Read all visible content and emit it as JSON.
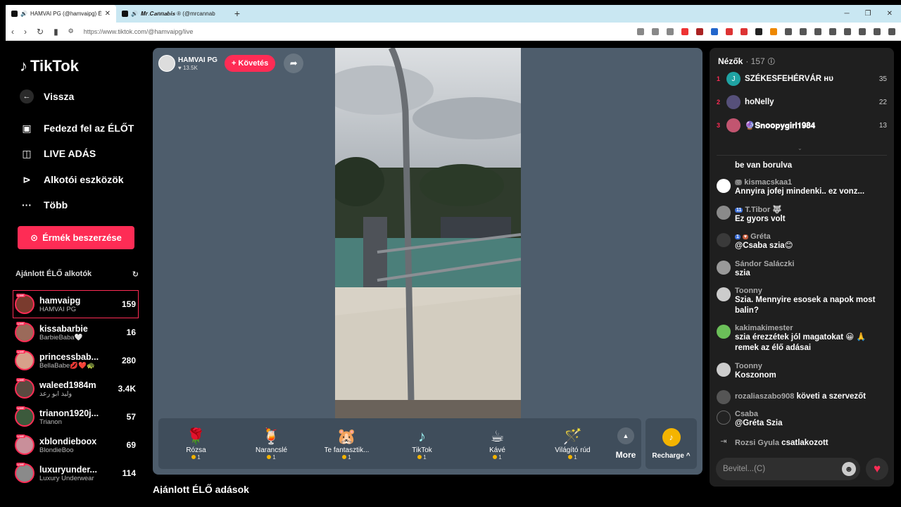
{
  "browser": {
    "tabs": [
      {
        "title": "HAMVAI PG (@hamvaipg) ÉL",
        "close": "✕"
      },
      {
        "title": "𝑴𝒓.𝑪𝒂𝒏𝒏𝒂𝒃𝒊𝒔 ® (@mrcannab"
      }
    ],
    "new_tab": "+",
    "url": "https://www.tiktok.com/@hamvaipg/live"
  },
  "sidebar": {
    "logo": "TikTok",
    "nav": [
      {
        "label": "Vissza",
        "icon": "back-arrow-icon"
      },
      {
        "label": "Fedezd fel az ÉLŐT",
        "icon": "live-explore-icon"
      },
      {
        "label": "LIVE ADÁS",
        "icon": "video-camera-icon"
      },
      {
        "label": "Alkotói eszközök",
        "icon": "creator-tools-icon"
      },
      {
        "label": "Több",
        "icon": "more-dots-icon"
      }
    ],
    "coins_button": "Érmék beszerzése",
    "recommended_title": "Ajánlott ÉLŐ alkotók",
    "creators": [
      {
        "name": "hamvaipg",
        "sub": "HAMVAI PG",
        "count": "159",
        "color": "#7a3b2e"
      },
      {
        "name": "kissabarbie",
        "sub": "BarbieBaba🤍",
        "count": "16",
        "color": "#9b6a5a"
      },
      {
        "name": "princessbab...",
        "sub": "BellaBabe💋❤️🐢",
        "count": "280",
        "color": "#d7a08a"
      },
      {
        "name": "waleed1984m",
        "sub": "وليد ابو رعد",
        "count": "3.4K",
        "color": "#5a4a40"
      },
      {
        "name": "trianon1920j...",
        "sub": "Trianon",
        "count": "57",
        "color": "#3c5a3c"
      },
      {
        "name": "xblondieboox",
        "sub": "BlondieBoo",
        "count": "69",
        "color": "#c98f9a"
      },
      {
        "name": "luxuryunder...",
        "sub": "Luxury Underwear",
        "count": "114",
        "color": "#8a8a8a"
      }
    ],
    "live_badge": "LIVE"
  },
  "stream": {
    "host_name": "HAMVAI PG",
    "host_likes": "♥ 13.5K",
    "follow_label": "+ Követés",
    "gifts": [
      {
        "name": "Rózsa",
        "price": "1",
        "icon": "🌹"
      },
      {
        "name": "Narancslé",
        "price": "1",
        "icon": "🍹"
      },
      {
        "name": "Te fantasztik...",
        "price": "1",
        "icon": "🐹"
      },
      {
        "name": "TikTok",
        "price": "1",
        "icon": "♪"
      },
      {
        "name": "Kávé",
        "price": "1",
        "icon": "☕"
      },
      {
        "name": "Világító rúd",
        "price": "1",
        "icon": "🪄"
      }
    ],
    "more_label": "More",
    "recharge_label": "Recharge ^",
    "suggested_title": "Ajánlott ÉLŐ adások"
  },
  "chat": {
    "viewers_label": "Nézők",
    "viewers_count": "· 157",
    "top_viewers": [
      {
        "rank": "1",
        "name": "SZÉKESFEHÉRVÁR ʜᴜ",
        "score": "35",
        "color": "#1fa3a3",
        "initial": "J"
      },
      {
        "rank": "2",
        "name": "hoNelly",
        "score": "22",
        "color": "#56507a",
        "initial": ""
      },
      {
        "rank": "3",
        "name": "🔮𝐒𝐧𝐨𝐨𝐩𝐲𝐠𝐢𝐫𝐥𝟏𝟗𝟖𝟒",
        "score": "13",
        "color": "#c25570",
        "initial": ""
      }
    ],
    "messages": [
      {
        "user": "",
        "text": "be van borulva",
        "color": "#6b5a50"
      },
      {
        "user": "kismacskaa1",
        "text": "Annyira jofej mindenki.. ez vonz...",
        "color": "#ffffff"
      },
      {
        "user": "T.Tibor 🐺",
        "text": "Ez gyors volt",
        "color": "#8a8a8a"
      },
      {
        "user": "Gréta",
        "text": "@Csaba szia😊",
        "color": "#3a3a3a"
      },
      {
        "user": "Sándor Saláczki",
        "text": "szia",
        "color": "#999999"
      },
      {
        "user": "Toonny",
        "text": "Szia. Mennyire esosek a napok most balin?",
        "color": "#cccccc"
      },
      {
        "user": "kakimakimester",
        "text": "szia érezzétek jól magatokat 😀 🙏 remek az élő adásai",
        "color": "#6bbf59"
      },
      {
        "user": "Toonny",
        "text": "Koszonom",
        "color": "#cccccc"
      },
      {
        "user": "rozaliaszabo908",
        "text": "követi a szervezőt",
        "color": "#555555"
      },
      {
        "user": "Csaba",
        "text": "@Gréta Szia",
        "color": "#222222"
      },
      {
        "user": "Rozsi Gyula",
        "text": "csatlakozott",
        "color": "#555555"
      }
    ],
    "badges": {
      "level_tibor": "11",
      "level_greta": "1"
    },
    "input_placeholder": "Bevitel...(C)"
  }
}
